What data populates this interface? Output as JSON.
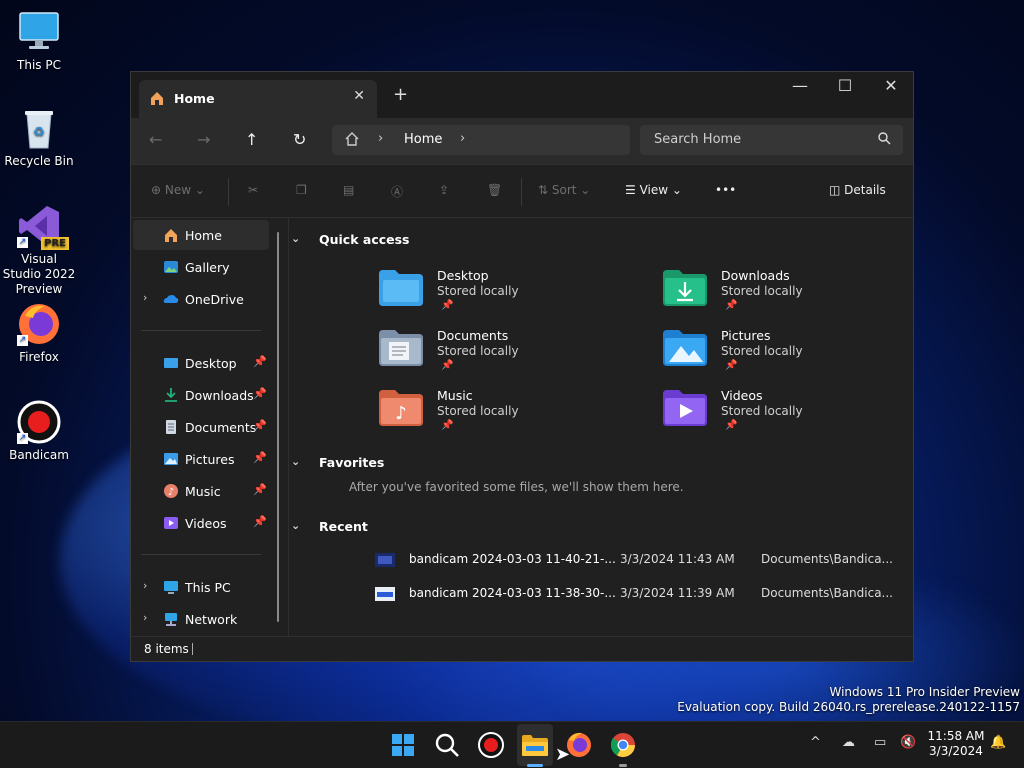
{
  "desktop": {
    "icons": [
      {
        "label": "This PC",
        "icon": "monitor-icon"
      },
      {
        "label": "Recycle Bin",
        "icon": "recycle-bin-icon"
      },
      {
        "label": "Visual Studio 2022 Preview",
        "badge": "PRE",
        "icon": "visual-studio-icon"
      },
      {
        "label": "Firefox",
        "icon": "firefox-icon"
      },
      {
        "label": "Bandicam",
        "icon": "bandicam-icon"
      }
    ],
    "watermark": {
      "line1": "Windows 11 Pro Insider Preview",
      "line2": "Evaluation copy. Build 26040.rs_prerelease.240122-1157"
    }
  },
  "explorer": {
    "tab": {
      "title": "Home",
      "close": "✕",
      "new_tab": "+"
    },
    "window_controls": {
      "minimize": "—",
      "maximize": "☐",
      "close": "✕"
    },
    "address": {
      "location": "Home",
      "separator": "›"
    },
    "search": {
      "placeholder": "Search Home"
    },
    "commands": {
      "new": "New",
      "sort": "Sort",
      "view": "View",
      "more": "•••",
      "details": "Details"
    },
    "sidebar": {
      "top": [
        {
          "label": "Home",
          "icon": "home-icon",
          "selected": true
        },
        {
          "label": "Gallery",
          "icon": "gallery-icon"
        },
        {
          "label": "OneDrive",
          "icon": "onedrive-icon",
          "expandable": true
        }
      ],
      "pinned": [
        {
          "label": "Desktop",
          "icon": "desktop-folder-icon"
        },
        {
          "label": "Downloads",
          "icon": "downloads-icon"
        },
        {
          "label": "Documents",
          "icon": "documents-icon"
        },
        {
          "label": "Pictures",
          "icon": "pictures-icon"
        },
        {
          "label": "Music",
          "icon": "music-icon"
        },
        {
          "label": "Videos",
          "icon": "videos-icon"
        }
      ],
      "bottom": [
        {
          "label": "This PC",
          "icon": "this-pc-icon"
        },
        {
          "label": "Network",
          "icon": "network-icon"
        }
      ]
    },
    "quick_access": {
      "heading": "Quick access",
      "items": [
        {
          "name": "Desktop",
          "status": "Stored locally",
          "color": "#3aa0e8"
        },
        {
          "name": "Downloads",
          "status": "Stored locally",
          "color": "#21b07a"
        },
        {
          "name": "Documents",
          "status": "Stored locally",
          "color": "#8fa3bd"
        },
        {
          "name": "Pictures",
          "status": "Stored locally",
          "color": "#3a9ce8"
        },
        {
          "name": "Music",
          "status": "Stored locally",
          "color": "#e8806a"
        },
        {
          "name": "Videos",
          "status": "Stored locally",
          "color": "#8a5cf0"
        }
      ]
    },
    "favorites": {
      "heading": "Favorites",
      "empty_text": "After you've favorited some files, we'll show them here."
    },
    "recent": {
      "heading": "Recent",
      "rows": [
        {
          "name": "bandicam 2024-03-03 11-40-21-...",
          "date": "3/3/2024 11:43 AM",
          "path": "Documents\\Bandica..."
        },
        {
          "name": "bandicam 2024-03-03 11-38-30-...",
          "date": "3/3/2024 11:39 AM",
          "path": "Documents\\Bandica..."
        }
      ]
    },
    "status": {
      "items": "8 items"
    }
  },
  "taskbar": {
    "clock": {
      "time": "11:58 AM",
      "date": "3/3/2024"
    },
    "tray_expand": "^"
  }
}
